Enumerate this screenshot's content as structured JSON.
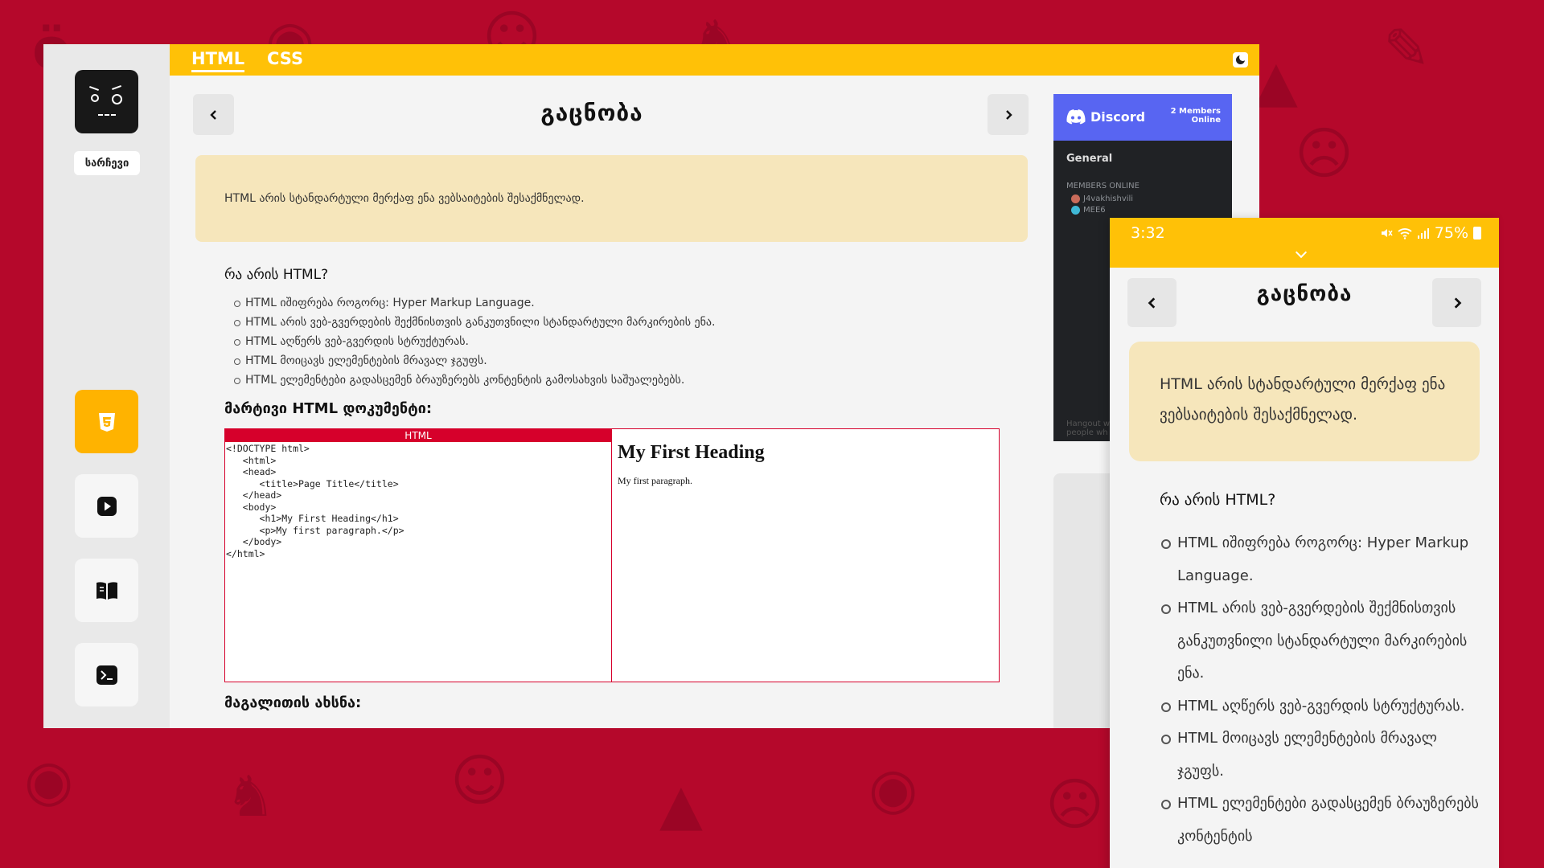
{
  "sidebar": {
    "menu_label": "სარჩევი",
    "icons": [
      "html5-icon",
      "youtube-icon",
      "book-icon",
      "terminal-icon"
    ]
  },
  "topbar": {
    "tabs": [
      {
        "label": "HTML",
        "active": true
      },
      {
        "label": "CSS",
        "active": false
      }
    ],
    "theme_toggle": "moon-icon"
  },
  "main": {
    "title": "გაცნობა",
    "intro": "HTML არის სტანდარტული მერქაფ ენა ვებსაიტების შესაქმნელად.",
    "what_heading": "რა არის HTML?",
    "bullets": [
      "HTML იშიფრება როგორც: Hyper Markup Language.",
      "HTML არის ვებ-გვერდების შექმნისთვის განკუთვნილი სტანდარტული მარკირების ენა.",
      "HTML აღწერს ვებ-გვერდის სტრუქტურას.",
      "HTML მოიცავს ელემენტების მრავალ ჯგუფს.",
      "HTML ელემენტები გადასცემენ ბრაუზერებს კონტენტის გამოსახვის საშუალებებს."
    ],
    "simple_heading": "მარტივი HTML დოკუმენტი:",
    "example": {
      "label": "HTML",
      "code": "<!DOCTYPE html>\n   <html>\n   <head>\n      <title>Page Title</title>\n   </head>\n   <body>\n      <h1>My First Heading</h1>\n      <p>My first paragraph.</p>\n   </body>\n</html>",
      "preview_heading": "My First Heading",
      "preview_paragraph": "My first paragraph."
    },
    "explain_heading": "მაგალითის ახსნა:"
  },
  "discord": {
    "brand": "Discord",
    "members_count_line1": "2 Members",
    "members_count_line2": "Online",
    "channel": "General",
    "members_online_label": "MEMBERS ONLINE",
    "members": [
      "J4vakhishvili",
      "MEE6"
    ],
    "footer": "Hangout w\npeople wh"
  },
  "phone": {
    "time": "3:32",
    "battery": "75%",
    "title": "გაცნობა",
    "intro": "HTML არის სტანდარტული მერქაფ ენა ვებსაიტების შესაქმნელად.",
    "what_heading": "რა არის HTML?",
    "bullets": [
      "HTML იშიფრება როგორც: Hyper Markup Language.",
      "HTML არის ვებ-გვერდების შექმნისთვის განკუთვნილი სტანდარტული მარკირების ენა.",
      "HTML აღწერს ვებ-გვერდის სტრუქტურას.",
      "HTML მოიცავს ელემენტების მრავალ ჯგუფს.",
      "HTML ელემენტები გადასცემენ ბრაუზერებს კონტენტის"
    ]
  },
  "colors": {
    "accent": "#ffc107",
    "background": "#b5082b",
    "intro_bg": "#f6e6bb",
    "example_border": "#d6002b",
    "discord_blurple": "#5865f2"
  }
}
